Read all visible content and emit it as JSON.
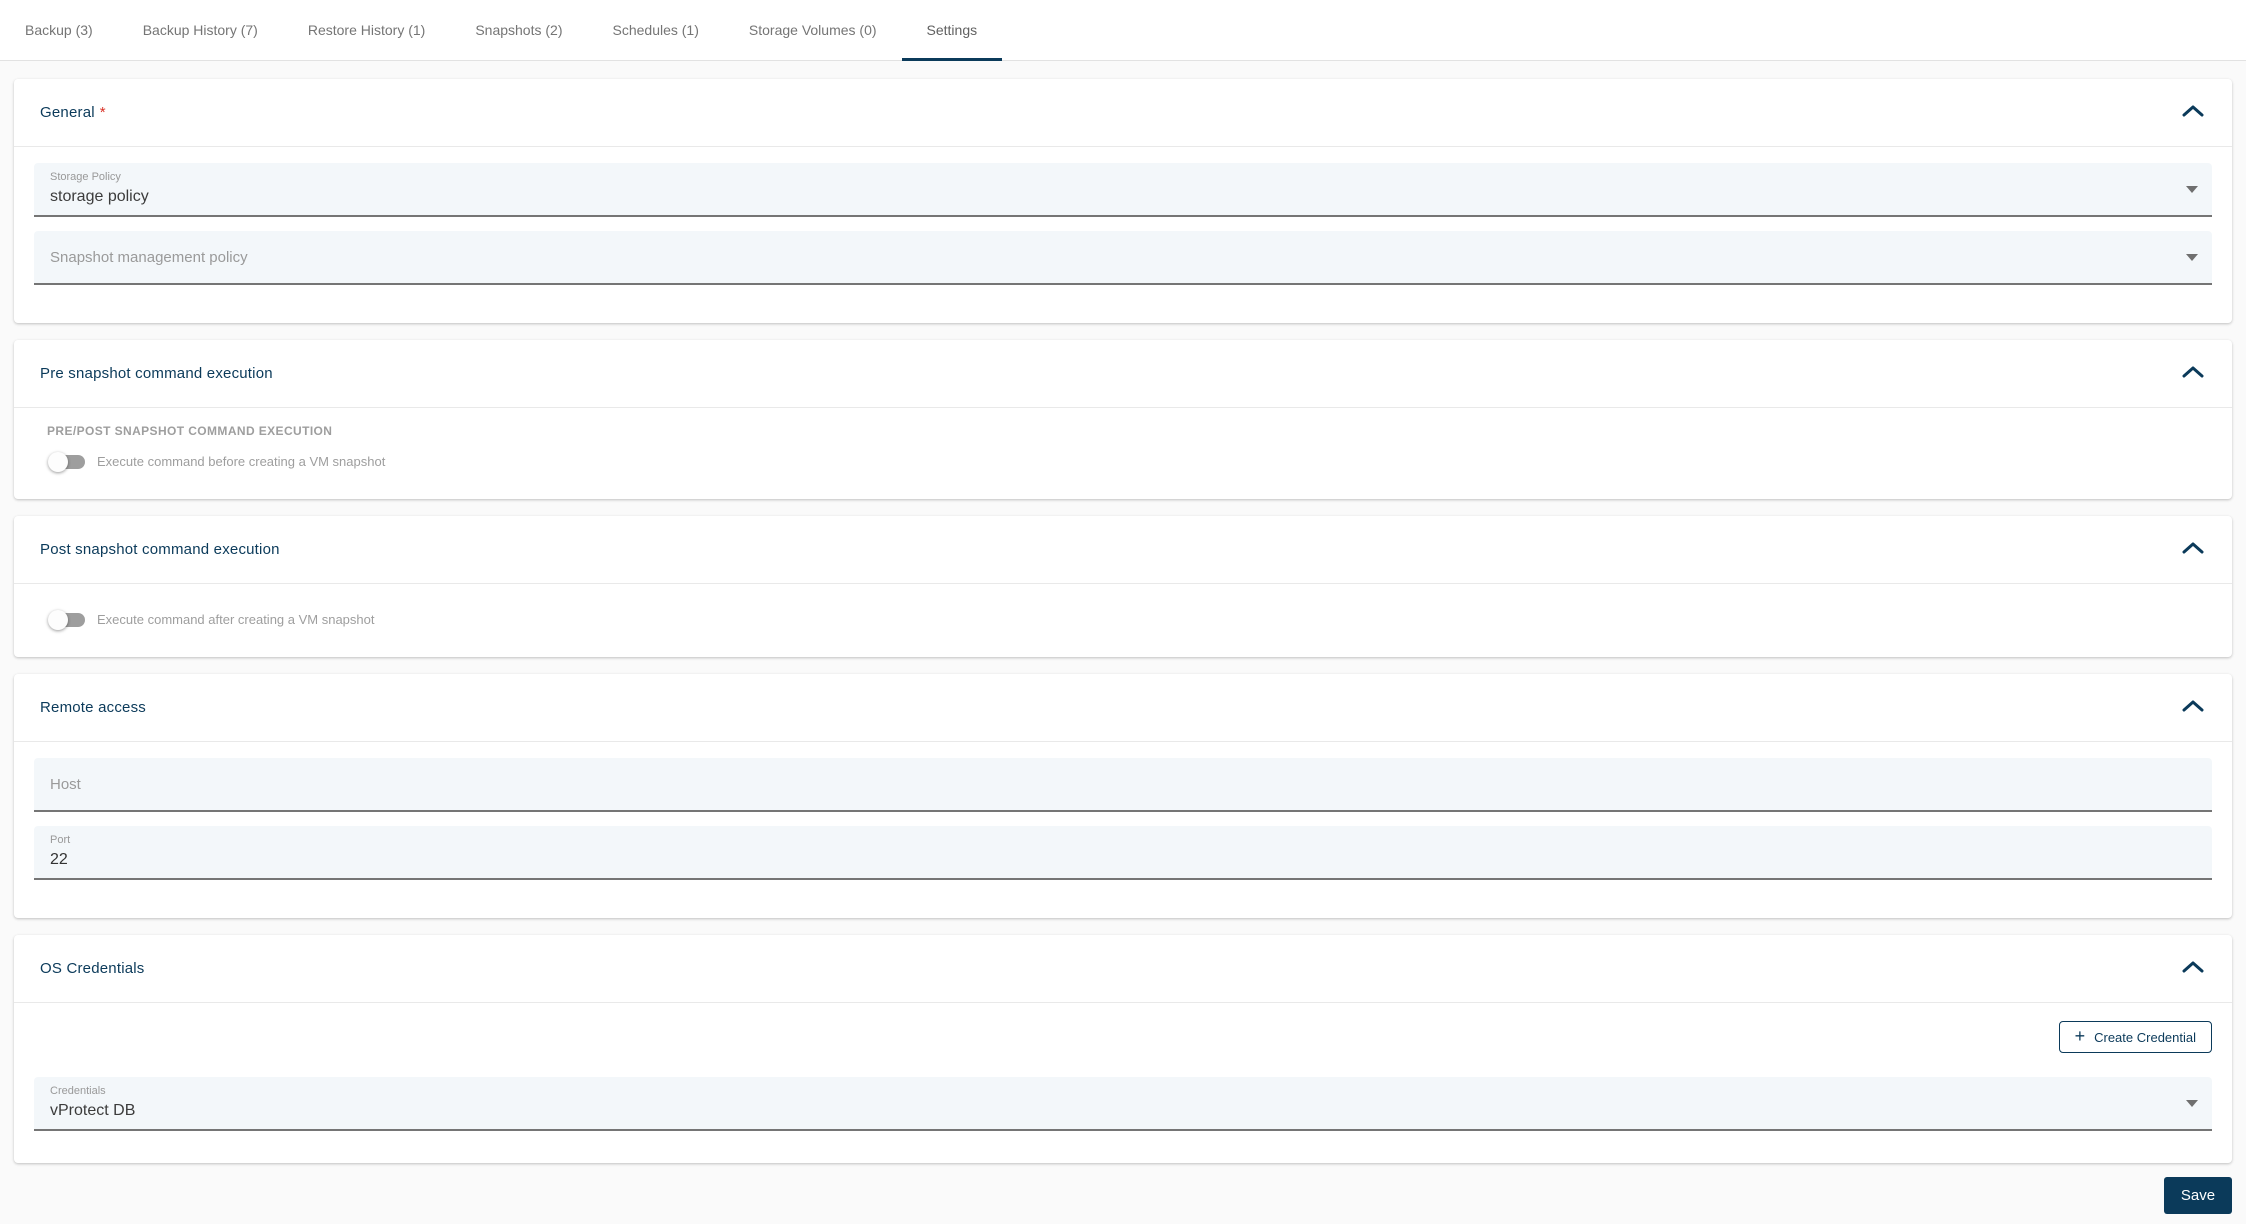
{
  "tabs": {
    "items": [
      {
        "label": "Backup (3)",
        "active": false
      },
      {
        "label": "Backup History (7)",
        "active": false
      },
      {
        "label": "Restore History (1)",
        "active": false
      },
      {
        "label": "Snapshots (2)",
        "active": false
      },
      {
        "label": "Schedules (1)",
        "active": false
      },
      {
        "label": "Storage Volumes (0)",
        "active": false
      },
      {
        "label": "Settings",
        "active": true
      }
    ]
  },
  "sections": {
    "general": {
      "title": "General",
      "required_marker": "*",
      "storage_policy": {
        "label": "Storage Policy",
        "value": "storage policy"
      },
      "snapshot_policy": {
        "placeholder": "Snapshot management policy"
      }
    },
    "pre_snapshot": {
      "title": "Pre snapshot command execution",
      "group_label": "PRE/POST SNAPSHOT COMMAND EXECUTION",
      "toggle_label": "Execute command before creating a VM snapshot",
      "toggle_state": "off"
    },
    "post_snapshot": {
      "title": "Post snapshot command execution",
      "toggle_label": "Execute command after creating a VM snapshot",
      "toggle_state": "off"
    },
    "remote_access": {
      "title": "Remote access",
      "host": {
        "placeholder": "Host"
      },
      "port": {
        "label": "Port",
        "value": "22"
      }
    },
    "os_credentials": {
      "title": "OS Credentials",
      "create_button_label": "Create Credential",
      "credentials": {
        "label": "Credentials",
        "value": "vProtect DB"
      }
    }
  },
  "footer": {
    "save_label": "Save"
  },
  "colors": {
    "primary_navy": "#0b3a5a",
    "required_red": "#d93025",
    "field_background": "#f3f7fa",
    "tab_text_gray": "#757575",
    "muted_gray": "#9e9e9e"
  }
}
